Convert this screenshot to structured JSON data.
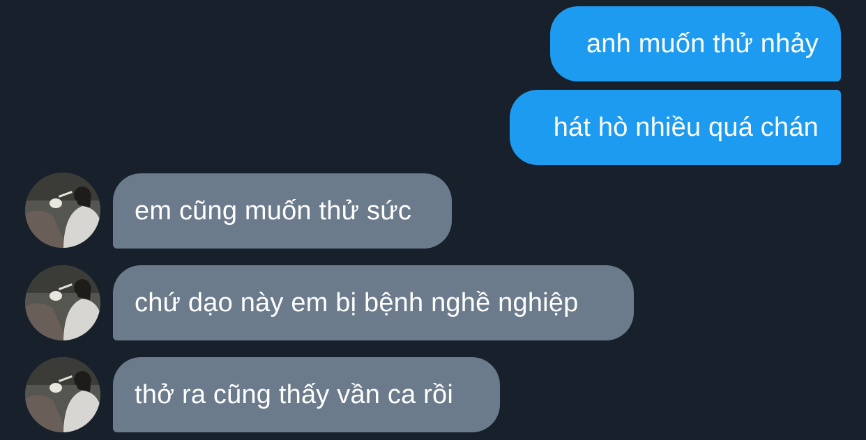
{
  "messages": [
    {
      "direction": "sent",
      "text": "anh muốn thử nhảy"
    },
    {
      "direction": "sent",
      "text": "hát hò nhiều quá chán"
    },
    {
      "direction": "received",
      "text": "em cũng muốn thử sức"
    },
    {
      "direction": "received",
      "text": "chứ dạo này em bị bệnh nghề nghiệp"
    },
    {
      "direction": "received",
      "text": "thở ra cũng thấy vần ca rồi"
    }
  ],
  "colors": {
    "background": "#17202b",
    "sent_bubble": "#1d9bf0",
    "received_bubble": "#6b7b8b",
    "text": "#ffffff"
  },
  "avatar": {
    "icon": "user-avatar-photo"
  }
}
